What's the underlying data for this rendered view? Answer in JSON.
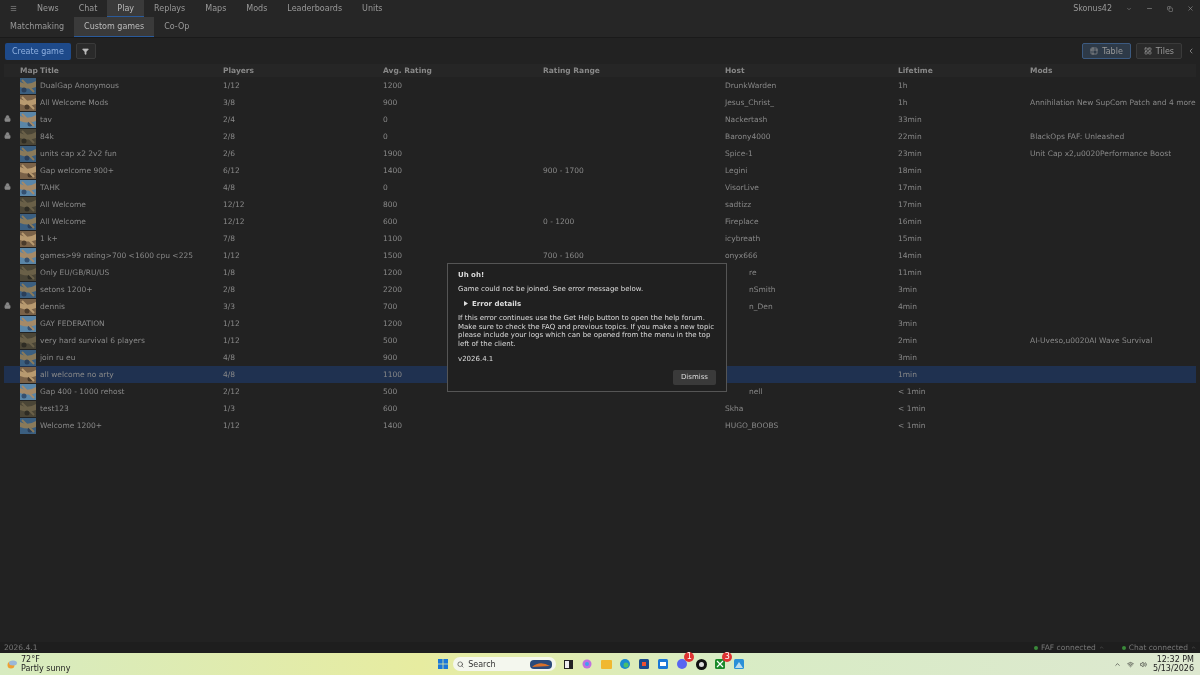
{
  "nav": {
    "tabs": [
      {
        "label": "News",
        "selected": false
      },
      {
        "label": "Chat",
        "selected": false
      },
      {
        "label": "Play",
        "selected": true
      },
      {
        "label": "Replays",
        "selected": false
      },
      {
        "label": "Maps",
        "selected": false
      },
      {
        "label": "Mods",
        "selected": false
      },
      {
        "label": "Leaderboards",
        "selected": false
      },
      {
        "label": "Units",
        "selected": false
      }
    ],
    "user": "Skonus42"
  },
  "subtabs": [
    {
      "label": "Matchmaking",
      "selected": false
    },
    {
      "label": "Custom games",
      "selected": true
    },
    {
      "label": "Co-Op",
      "selected": false
    }
  ],
  "toolbar": {
    "create": "Create game",
    "views": [
      {
        "label": "Table",
        "kind": "table",
        "selected": true
      },
      {
        "label": "Tiles",
        "kind": "tiles",
        "selected": false
      }
    ]
  },
  "table": {
    "columns": [
      "Map",
      "Title",
      "Players",
      "Avg. Rating",
      "Rating Range",
      "Host",
      "Lifetime",
      "Mods"
    ],
    "rows": [
      {
        "locked": false,
        "selected": false,
        "title": "DualGap Anonymous",
        "players": "1/12",
        "avg": "1200",
        "host": "DrunkWarden",
        "lifetime": "1h"
      },
      {
        "locked": false,
        "selected": false,
        "title": "All Welcome Mods",
        "players": "3/8",
        "avg": "900",
        "host": "Jesus_Christ_",
        "lifetime": "1h",
        "mods": "Annihilation New SupCom Patch and 4 more"
      },
      {
        "locked": true,
        "selected": false,
        "title": "tav",
        "players": "2/4",
        "avg": "0",
        "host": "Nackertash",
        "lifetime": "33min"
      },
      {
        "locked": true,
        "selected": false,
        "title": "84k",
        "players": "2/8",
        "avg": "0",
        "host": "Barony4000",
        "lifetime": "22min",
        "mods": "BlackOps FAF: Unleashed"
      },
      {
        "locked": false,
        "selected": false,
        "title": "units cap x2 2v2 fun",
        "players": "2/6",
        "avg": "1900",
        "host": "Spice-1",
        "lifetime": "23min",
        "mods": "Unit Cap x2,u0020Performance Boost"
      },
      {
        "locked": false,
        "selected": false,
        "title": "Gap welcome 900+",
        "players": "6/12",
        "avg": "1400",
        "range": "900 - 1700",
        "host": "Legini",
        "lifetime": "18min"
      },
      {
        "locked": true,
        "selected": false,
        "title": "TAHK",
        "players": "4/8",
        "avg": "0",
        "host": "VisorLive",
        "lifetime": "17min"
      },
      {
        "locked": false,
        "selected": false,
        "title": "All Welcome",
        "players": "12/12",
        "avg": "800",
        "host": "sadtizz",
        "lifetime": "17min"
      },
      {
        "locked": false,
        "selected": false,
        "title": "All Welcome",
        "players": "12/12",
        "avg": "600",
        "range": "0 - 1200",
        "host": "Fireplace",
        "lifetime": "16min"
      },
      {
        "locked": false,
        "selected": false,
        "title": "1 k+",
        "players": "7/8",
        "avg": "1100",
        "host": "icybreath",
        "lifetime": "15min"
      },
      {
        "locked": false,
        "selected": false,
        "title": "games>99 rating>700 <1600 cpu <225",
        "players": "1/12",
        "avg": "1500",
        "range": "700 - 1600",
        "host": "onyx666",
        "lifetime": "14min"
      },
      {
        "locked": false,
        "selected": false,
        "title": "Only EU/GB/RU/US",
        "players": "1/8",
        "avg": "1200",
        "host": "re",
        "host_clipped": true,
        "lifetime": "11min"
      },
      {
        "locked": false,
        "selected": false,
        "title": "setons 1200+",
        "players": "2/8",
        "avg": "2200",
        "host": "nSmith",
        "host_clipped": true,
        "lifetime": "3min"
      },
      {
        "locked": true,
        "selected": false,
        "title": "dennis",
        "players": "3/3",
        "avg": "700",
        "host": "n_Den",
        "host_clipped": true,
        "lifetime": "4min"
      },
      {
        "locked": false,
        "selected": false,
        "title": "GAY FEDERATION",
        "players": "1/12",
        "avg": "1200",
        "lifetime": "3min"
      },
      {
        "locked": false,
        "selected": false,
        "title": "very hard survival 6 players",
        "players": "1/12",
        "avg": "500",
        "lifetime": "2min",
        "mods": "AI-Uveso,u0020AI Wave Survival"
      },
      {
        "locked": false,
        "selected": false,
        "title": "join ru eu",
        "players": "4/8",
        "avg": "900",
        "lifetime": "3min"
      },
      {
        "locked": false,
        "selected": true,
        "title": "all welcome no arty",
        "players": "4/8",
        "avg": "1100",
        "lifetime": "1min"
      },
      {
        "locked": false,
        "selected": false,
        "title": "Gap 400 - 1000 rehost",
        "players": "2/12",
        "avg": "500",
        "host": "nell",
        "host_clipped": true,
        "lifetime": "< 1min"
      },
      {
        "locked": false,
        "selected": false,
        "title": "test123",
        "players": "1/3",
        "avg": "600",
        "host": "Skha",
        "lifetime": "< 1min"
      },
      {
        "locked": false,
        "selected": false,
        "title": "Welcome 1200+",
        "players": "1/12",
        "avg": "1400",
        "host": "HUGO_BOOBS",
        "lifetime": "< 1min"
      }
    ]
  },
  "dialog": {
    "title": "Uh oh!",
    "message": "Game could not be joined. See error message below.",
    "details": "Error details",
    "expanded": false,
    "help": "If this error continues use the Get Help button to open the help forum. Make sure to check the FAQ and previous topics. If you make a new topic please include your logs which can be opened from the menu in the top left of the client.",
    "version": "v2026.4.1",
    "button": "Dismiss"
  },
  "status_bar": {
    "version": "2026.4.1",
    "items": [
      {
        "label": "FAF connected",
        "on": true
      },
      {
        "label": "Chat connected",
        "on": true
      }
    ]
  },
  "taskbar": {
    "weather": {
      "temp": "72°F",
      "text": "Partly sunny"
    },
    "search": "Search",
    "badges": {
      "discord": "1",
      "xbox": "3"
    },
    "time": "12:32 PM",
    "date": "5/13/2026"
  }
}
